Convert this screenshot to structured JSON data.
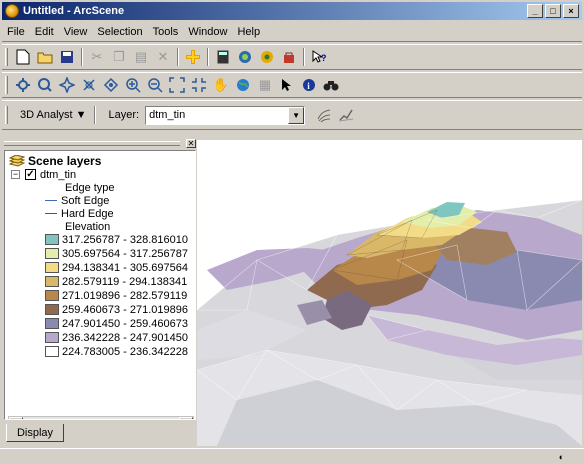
{
  "window": {
    "title": "Untitled - ArcScene",
    "min": "_",
    "max": "□",
    "close": "×"
  },
  "menu": [
    "File",
    "Edit",
    "View",
    "Selection",
    "Tools",
    "Window",
    "Help"
  ],
  "analyst": {
    "label": "3D Analyst ▼",
    "layer_label": "Layer:",
    "layer_value": "dtm_tin"
  },
  "toc": {
    "root": "Scene layers",
    "layer": "dtm_tin",
    "edge_heading": "Edge type",
    "edges": [
      {
        "label": "Soft Edge",
        "color": "#3a6cb0"
      },
      {
        "label": "Hard Edge",
        "color": "#555555"
      }
    ],
    "elev_heading": "Elevation",
    "classes": [
      {
        "label": "317.256787 - 328.816010",
        "color": "#7fc6c0"
      },
      {
        "label": "305.697564 - 317.256787",
        "color": "#e3eeaa"
      },
      {
        "label": "294.138341 - 305.697564",
        "color": "#f2dc88"
      },
      {
        "label": "282.579119 - 294.138341",
        "color": "#d9b868"
      },
      {
        "label": "271.019896 - 282.579119",
        "color": "#b8874a"
      },
      {
        "label": "259.460673 - 271.019896",
        "color": "#8f6a4e"
      },
      {
        "label": "247.901450 - 259.460673",
        "color": "#8a8ab0"
      },
      {
        "label": "236.342228 - 247.901450",
        "color": "#b8a8cc"
      },
      {
        "label": "224.783005 - 236.342228",
        "color": "#ffffff"
      }
    ],
    "tab": "Display"
  }
}
